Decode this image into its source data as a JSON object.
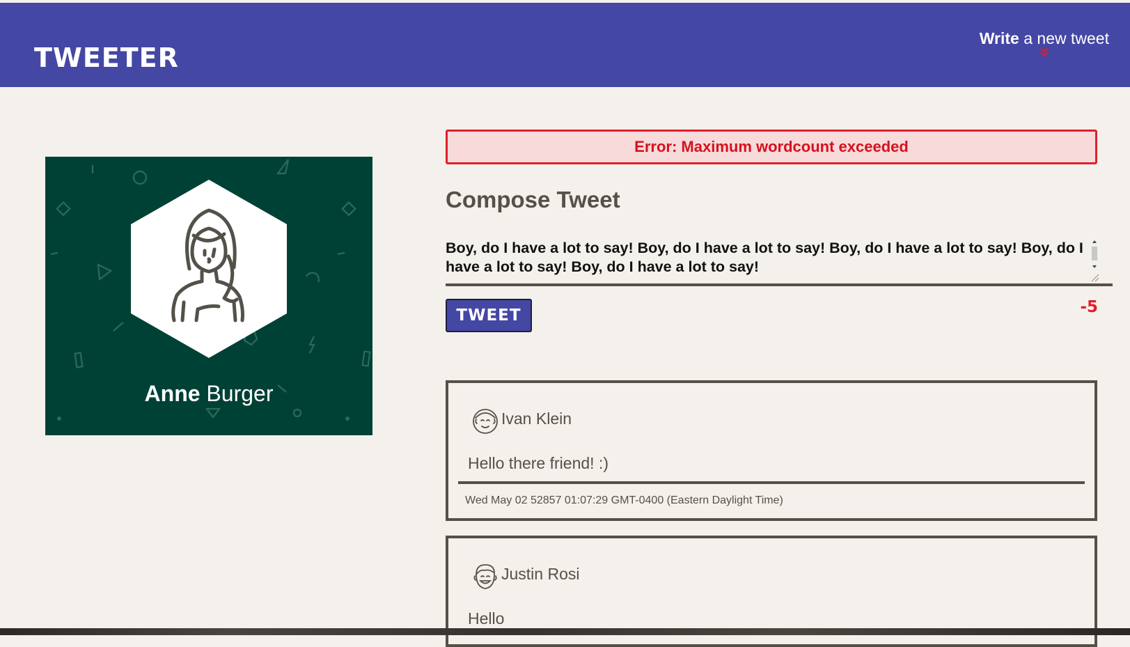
{
  "app": {
    "brand": "TWEETER",
    "compose_toggle": {
      "bold": "Write",
      "rest": " a new tweet"
    }
  },
  "profile": {
    "first_name": "Anne",
    "last_name": " Burger",
    "avatar_icon": "woman-avatar-icon"
  },
  "composer": {
    "error": "Error: Maximum wordcount exceeded",
    "title": "Compose Tweet",
    "text": "Boy, do I have a lot to say! Boy, do I have a lot to say! Boy, do I have a lot to say! Boy, do I have a lot to say! Boy, do I have a lot to say!",
    "button": "TWEET",
    "counter": "-5"
  },
  "tweets": [
    {
      "author": "Ivan Klein",
      "content": "Hello there friend! :)",
      "timestamp": "Wed May 02 52857 01:07:29 GMT-0400 (Eastern Daylight Time)"
    },
    {
      "author": "Justin Rosi",
      "content": "Hello"
    }
  ],
  "colors": {
    "nav": "#4447a3",
    "background": "#f4f1ec",
    "profile": "#004136",
    "error": "#e01f2b",
    "text": "#545149"
  }
}
